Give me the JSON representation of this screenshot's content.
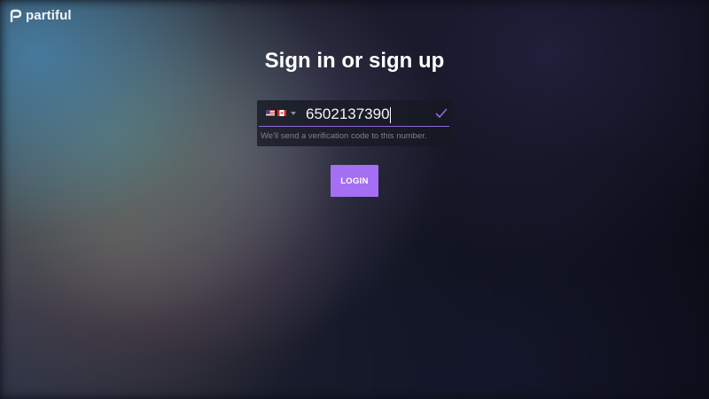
{
  "brand": {
    "name": "partiful",
    "icon": "partiful-logo-icon"
  },
  "page": {
    "title": "Sign in or sign up"
  },
  "phone": {
    "country_flags": [
      "us-flag-icon",
      "ca-flag-icon"
    ],
    "value": "6502137390",
    "hint": "We'll send a verification code to this number.",
    "valid_icon": "check-icon",
    "accent_color": "#8a69d8"
  },
  "actions": {
    "login_label": "LOGIN",
    "login_color": "#a46ff3"
  }
}
